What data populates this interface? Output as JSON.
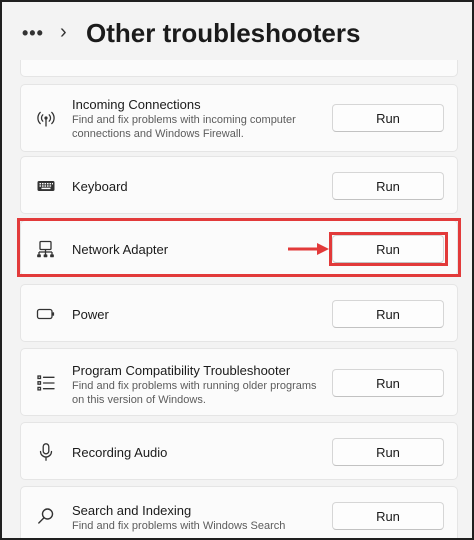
{
  "header": {
    "more_label": "•••",
    "chevron": "›",
    "title": "Other troubleshooters"
  },
  "items": [
    {
      "icon": "wifi-signal-icon",
      "name": "Incoming Connections",
      "description": "Find and fix problems with incoming computer connections and Windows Firewall.",
      "run_label": "Run"
    },
    {
      "icon": "keyboard-icon",
      "name": "Keyboard",
      "description": "",
      "run_label": "Run"
    },
    {
      "icon": "network-adapter-icon",
      "name": "Network Adapter",
      "description": "",
      "run_label": "Run"
    },
    {
      "icon": "battery-icon",
      "name": "Power",
      "description": "",
      "run_label": "Run"
    },
    {
      "icon": "list-icon",
      "name": "Program Compatibility Troubleshooter",
      "description": "Find and fix problems with running older programs on this version of Windows.",
      "run_label": "Run"
    },
    {
      "icon": "microphone-icon",
      "name": "Recording Audio",
      "description": "",
      "run_label": "Run"
    },
    {
      "icon": "search-icon",
      "name": "Search and Indexing",
      "description": "Find and fix problems with Windows Search",
      "run_label": "Run"
    }
  ],
  "colors": {
    "highlight": "#e23a3a",
    "background": "#f3f3f3",
    "card": "#fbfbfb"
  }
}
